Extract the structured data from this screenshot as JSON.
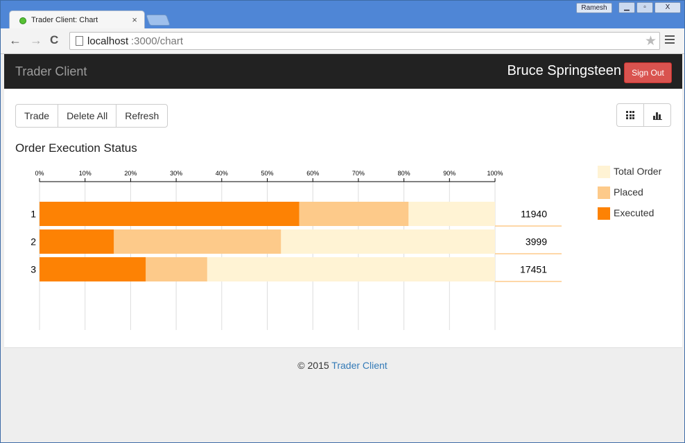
{
  "browser": {
    "tab_title": "Trader Client: Chart",
    "tab_close": "×",
    "user_chip": "Ramesh",
    "window_minimize": "▁",
    "window_maximize": "▫",
    "window_close": "X",
    "url_host": "localhost",
    "url_path": ":3000/chart",
    "back_icon": "←",
    "forward_icon": "→",
    "reload_icon": "C",
    "star_icon": "★"
  },
  "navbar": {
    "brand": "Trader Client",
    "user_name": "Bruce Springsteen",
    "signout_label": "Sign Out"
  },
  "toolbar": {
    "trade_label": "Trade",
    "delete_all_label": "Delete All",
    "refresh_label": "Refresh"
  },
  "chart_title": "Order Execution Status",
  "colors": {
    "total": "#fff3d4",
    "placed": "#fdca8a",
    "executed": "#fd8204",
    "axis": "#000000",
    "grid": "#dddddd"
  },
  "chart_data": {
    "type": "bar",
    "orientation": "horizontal",
    "stacked": true,
    "title": "Order Execution Status",
    "xlim": [
      0,
      100
    ],
    "x_ticks": [
      "0%",
      "10%",
      "20%",
      "30%",
      "40%",
      "50%",
      "60%",
      "70%",
      "80%",
      "90%",
      "100%"
    ],
    "categories": [
      "1",
      "2",
      "3"
    ],
    "totals": [
      11940,
      3999,
      17451
    ],
    "series": [
      {
        "name": "Executed",
        "values": [
          57,
          16.3,
          23.3
        ]
      },
      {
        "name": "Placed",
        "values": [
          81,
          53,
          36.8
        ]
      },
      {
        "name": "Total Order",
        "values": [
          100,
          100,
          100
        ]
      }
    ],
    "legend": [
      "Total Order",
      "Placed",
      "Executed"
    ],
    "legend_position": "right",
    "grid": true
  },
  "footer": {
    "copyright": "© 2015 ",
    "link": "Trader Client"
  }
}
